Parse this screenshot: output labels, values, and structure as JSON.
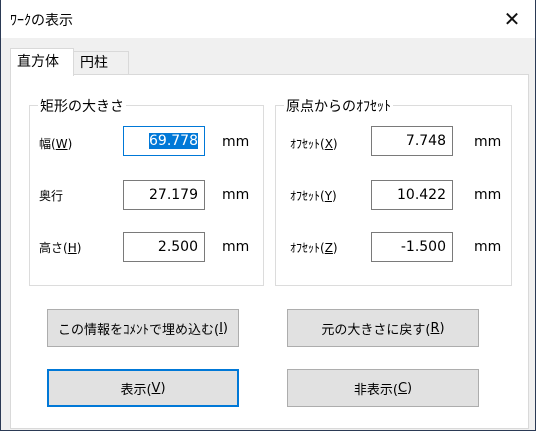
{
  "window": {
    "title": "ﾜｰｸの表示",
    "close_icon": "close-icon"
  },
  "tabs": [
    {
      "label": "直方体",
      "selected": true
    },
    {
      "label": "円柱",
      "selected": false
    }
  ],
  "size_group": {
    "legend": "矩形の大きさ",
    "fields": [
      {
        "label": "幅(",
        "key": "W",
        "close": ")",
        "value": "69.778",
        "unit": "mm",
        "selected": true
      },
      {
        "label": "奥行",
        "key": "",
        "close": "",
        "value": "27.179",
        "unit": "mm"
      },
      {
        "label": "高さ(",
        "key": "H",
        "close": ")",
        "value": "2.500",
        "unit": "mm"
      }
    ]
  },
  "offset_group": {
    "legend": "原点からのｵﾌｾｯﾄ",
    "fields": [
      {
        "label": "ｵﾌｾｯﾄ(",
        "key": "X",
        "close": ")",
        "value": "7.748",
        "unit": "mm"
      },
      {
        "label": "ｵﾌｾｯﾄ(",
        "key": "Y",
        "close": ")",
        "value": "10.422",
        "unit": "mm"
      },
      {
        "label": "ｵﾌｾｯﾄ(",
        "key": "Z",
        "close": ")",
        "value": "-1.500",
        "unit": "mm"
      }
    ]
  },
  "buttons": {
    "embed": {
      "label": "この情報をｺﾒﾝﾄで埋め込む(",
      "key": "I",
      "close": ")"
    },
    "reset": {
      "label": "元の大きさに戻す(",
      "key": "R",
      "close": ")"
    },
    "show": {
      "label": "表示(",
      "key": "V",
      "close": ")"
    },
    "hide": {
      "label": "非表示(",
      "key": "C",
      "close": ")"
    }
  },
  "colors": {
    "accent": "#0078d7",
    "button_bg": "#e1e1e1",
    "dialog_bg": "#f0f0f0"
  }
}
